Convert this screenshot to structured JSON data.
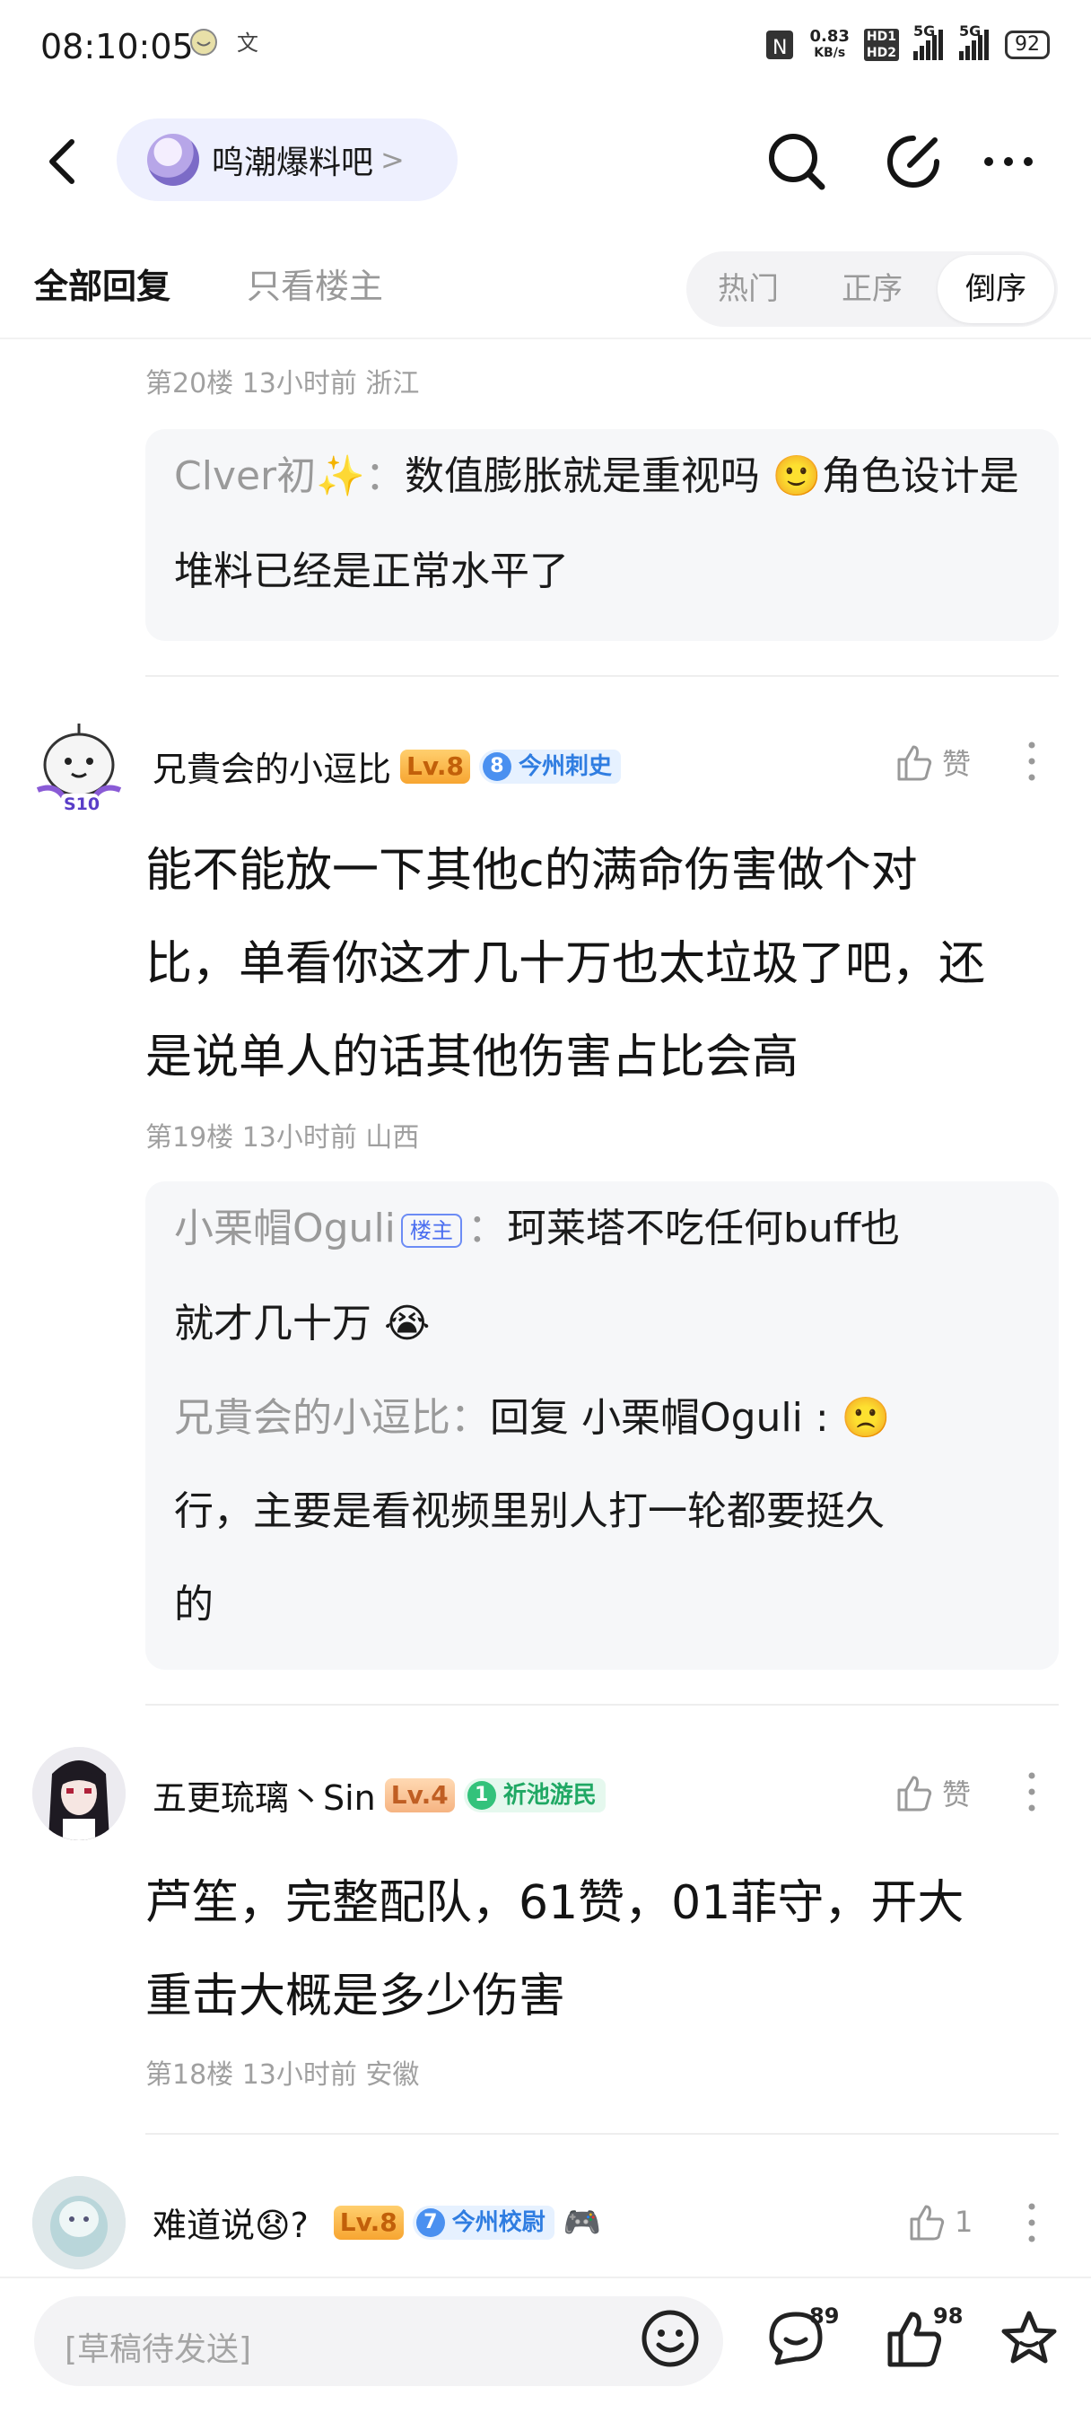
{
  "status_bar": {
    "time": "08:10:05",
    "net_speed_top": "0.83",
    "net_speed_unit": "KB/s",
    "hd1": "HD1",
    "hd2": "HD2",
    "sig1": "5G",
    "sig2": "5G",
    "battery": "92"
  },
  "nav": {
    "forum_name": "鸣潮爆料吧",
    "forum_arrow": ">"
  },
  "tabs": {
    "all_replies": "全部回复",
    "op_only": "只看楼主",
    "sort": [
      "热门",
      "正序",
      "倒序"
    ],
    "active_sort": "倒序"
  },
  "posts": [
    {
      "meta": "第20楼  13小时前  浙江",
      "sub_replies": [
        {
          "name": "Clver初✨",
          "text": "数值膨胀就是重视吗 🙂角色设计是堆料已经是正常水平了"
        }
      ]
    },
    {
      "username": "兄貴会的小逗比",
      "level": "Lv.8",
      "badge_num": "8",
      "badge_text": "今州刺史",
      "like_label": "赞",
      "body_lines": [
        "能不能放一下其他c的满命伤害做个对",
        "比，单看你这才几十万也太垃圾了吧，还",
        "是说单人的话其他伤害占比会高"
      ],
      "meta": "第19楼  13小时前  山西",
      "sub_replies": [
        {
          "name": "小栗帽Oguli",
          "op_tag": "楼主",
          "line1": "珂莱塔不吃任何buff也",
          "line2": "就才几十万 😭"
        },
        {
          "name": "兄貴会的小逗比",
          "line1": "回复 小栗帽Oguli : 🙁",
          "line2": "行，主要是看视频里别人打一轮都要挺久",
          "line3": "的"
        }
      ]
    },
    {
      "username": "五更琉璃丶Sin",
      "level": "Lv.4",
      "badge_num": "1",
      "badge_text": "祈池游民",
      "like_label": "赞",
      "body_lines": [
        "芦笙，完整配队，61赞，01菲守，开大",
        "重击大概是多少伤害"
      ],
      "meta": "第18楼  13小时前  安徽"
    },
    {
      "username": "难道说😧?",
      "level": "Lv.8",
      "badge_num": "7",
      "badge_text": "今州校尉",
      "emoji": "🎮",
      "like_count": "1"
    }
  ],
  "bottom_bar": {
    "draft_placeholder": "[草稿待发送]",
    "comment_count": "89",
    "like_count": "98"
  },
  "avatar_labels": {
    "s10": "S10"
  }
}
